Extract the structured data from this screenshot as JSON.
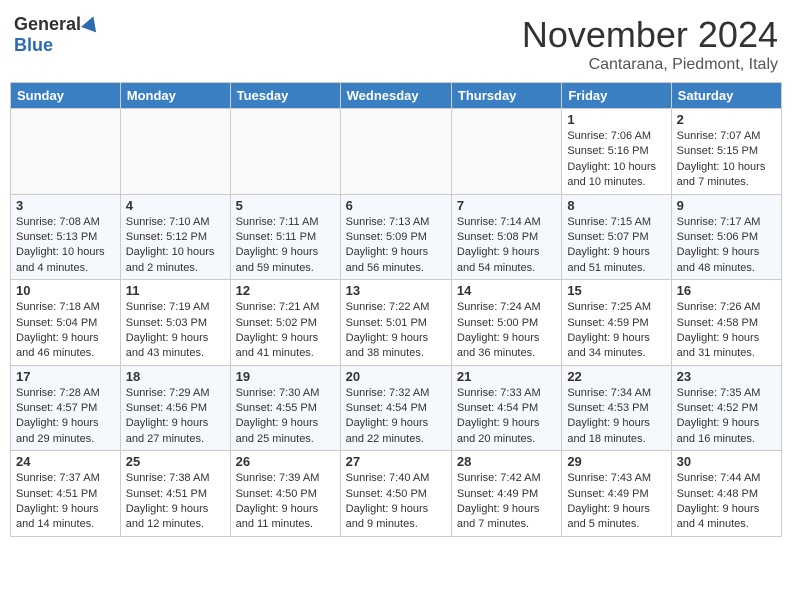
{
  "logo": {
    "general": "General",
    "blue": "Blue"
  },
  "title": "November 2024",
  "location": "Cantarana, Piedmont, Italy",
  "weekdays": [
    "Sunday",
    "Monday",
    "Tuesday",
    "Wednesday",
    "Thursday",
    "Friday",
    "Saturday"
  ],
  "weeks": [
    [
      {
        "day": "",
        "info": ""
      },
      {
        "day": "",
        "info": ""
      },
      {
        "day": "",
        "info": ""
      },
      {
        "day": "",
        "info": ""
      },
      {
        "day": "",
        "info": ""
      },
      {
        "day": "1",
        "info": "Sunrise: 7:06 AM\nSunset: 5:16 PM\nDaylight: 10 hours\nand 10 minutes."
      },
      {
        "day": "2",
        "info": "Sunrise: 7:07 AM\nSunset: 5:15 PM\nDaylight: 10 hours\nand 7 minutes."
      }
    ],
    [
      {
        "day": "3",
        "info": "Sunrise: 7:08 AM\nSunset: 5:13 PM\nDaylight: 10 hours\nand 4 minutes."
      },
      {
        "day": "4",
        "info": "Sunrise: 7:10 AM\nSunset: 5:12 PM\nDaylight: 10 hours\nand 2 minutes."
      },
      {
        "day": "5",
        "info": "Sunrise: 7:11 AM\nSunset: 5:11 PM\nDaylight: 9 hours\nand 59 minutes."
      },
      {
        "day": "6",
        "info": "Sunrise: 7:13 AM\nSunset: 5:09 PM\nDaylight: 9 hours\nand 56 minutes."
      },
      {
        "day": "7",
        "info": "Sunrise: 7:14 AM\nSunset: 5:08 PM\nDaylight: 9 hours\nand 54 minutes."
      },
      {
        "day": "8",
        "info": "Sunrise: 7:15 AM\nSunset: 5:07 PM\nDaylight: 9 hours\nand 51 minutes."
      },
      {
        "day": "9",
        "info": "Sunrise: 7:17 AM\nSunset: 5:06 PM\nDaylight: 9 hours\nand 48 minutes."
      }
    ],
    [
      {
        "day": "10",
        "info": "Sunrise: 7:18 AM\nSunset: 5:04 PM\nDaylight: 9 hours\nand 46 minutes."
      },
      {
        "day": "11",
        "info": "Sunrise: 7:19 AM\nSunset: 5:03 PM\nDaylight: 9 hours\nand 43 minutes."
      },
      {
        "day": "12",
        "info": "Sunrise: 7:21 AM\nSunset: 5:02 PM\nDaylight: 9 hours\nand 41 minutes."
      },
      {
        "day": "13",
        "info": "Sunrise: 7:22 AM\nSunset: 5:01 PM\nDaylight: 9 hours\nand 38 minutes."
      },
      {
        "day": "14",
        "info": "Sunrise: 7:24 AM\nSunset: 5:00 PM\nDaylight: 9 hours\nand 36 minutes."
      },
      {
        "day": "15",
        "info": "Sunrise: 7:25 AM\nSunset: 4:59 PM\nDaylight: 9 hours\nand 34 minutes."
      },
      {
        "day": "16",
        "info": "Sunrise: 7:26 AM\nSunset: 4:58 PM\nDaylight: 9 hours\nand 31 minutes."
      }
    ],
    [
      {
        "day": "17",
        "info": "Sunrise: 7:28 AM\nSunset: 4:57 PM\nDaylight: 9 hours\nand 29 minutes."
      },
      {
        "day": "18",
        "info": "Sunrise: 7:29 AM\nSunset: 4:56 PM\nDaylight: 9 hours\nand 27 minutes."
      },
      {
        "day": "19",
        "info": "Sunrise: 7:30 AM\nSunset: 4:55 PM\nDaylight: 9 hours\nand 25 minutes."
      },
      {
        "day": "20",
        "info": "Sunrise: 7:32 AM\nSunset: 4:54 PM\nDaylight: 9 hours\nand 22 minutes."
      },
      {
        "day": "21",
        "info": "Sunrise: 7:33 AM\nSunset: 4:54 PM\nDaylight: 9 hours\nand 20 minutes."
      },
      {
        "day": "22",
        "info": "Sunrise: 7:34 AM\nSunset: 4:53 PM\nDaylight: 9 hours\nand 18 minutes."
      },
      {
        "day": "23",
        "info": "Sunrise: 7:35 AM\nSunset: 4:52 PM\nDaylight: 9 hours\nand 16 minutes."
      }
    ],
    [
      {
        "day": "24",
        "info": "Sunrise: 7:37 AM\nSunset: 4:51 PM\nDaylight: 9 hours\nand 14 minutes."
      },
      {
        "day": "25",
        "info": "Sunrise: 7:38 AM\nSunset: 4:51 PM\nDaylight: 9 hours\nand 12 minutes."
      },
      {
        "day": "26",
        "info": "Sunrise: 7:39 AM\nSunset: 4:50 PM\nDaylight: 9 hours\nand 11 minutes."
      },
      {
        "day": "27",
        "info": "Sunrise: 7:40 AM\nSunset: 4:50 PM\nDaylight: 9 hours\nand 9 minutes."
      },
      {
        "day": "28",
        "info": "Sunrise: 7:42 AM\nSunset: 4:49 PM\nDaylight: 9 hours\nand 7 minutes."
      },
      {
        "day": "29",
        "info": "Sunrise: 7:43 AM\nSunset: 4:49 PM\nDaylight: 9 hours\nand 5 minutes."
      },
      {
        "day": "30",
        "info": "Sunrise: 7:44 AM\nSunset: 4:48 PM\nDaylight: 9 hours\nand 4 minutes."
      }
    ]
  ]
}
